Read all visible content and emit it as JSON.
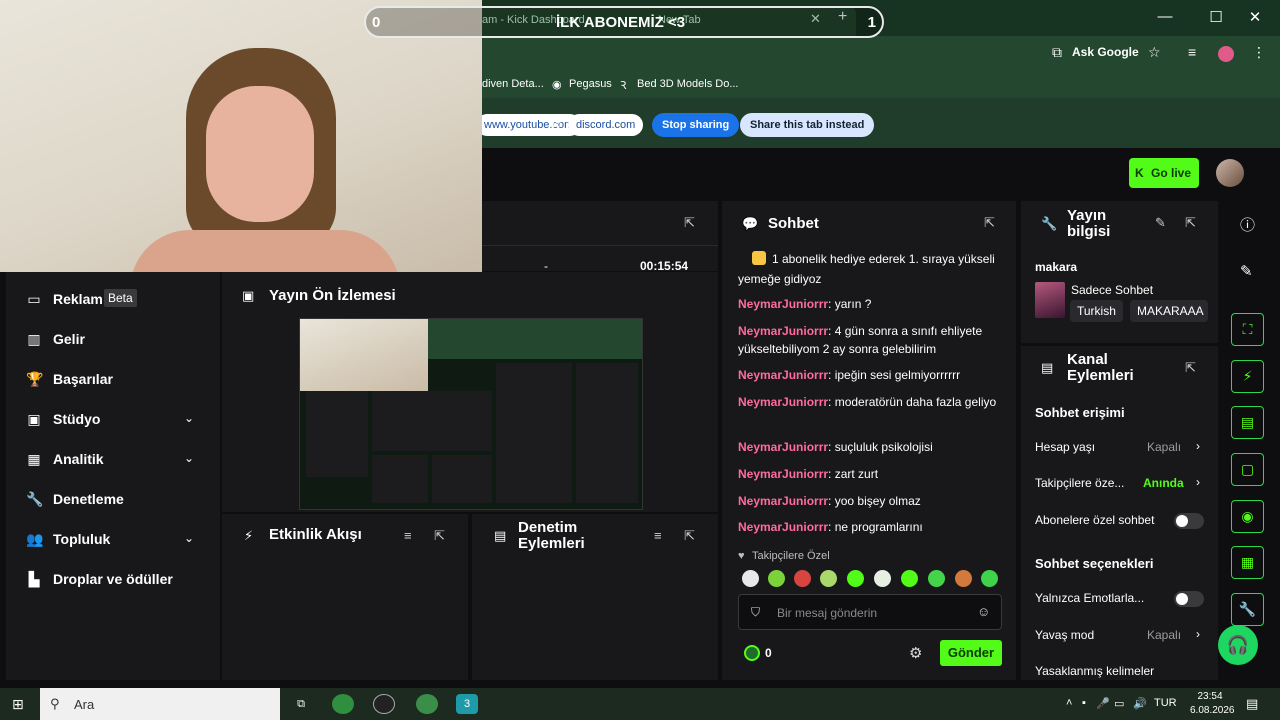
{
  "overlay": {
    "goal_left": "0",
    "goal_title": "İLK ABONEMİZ <3",
    "goal_right": "1"
  },
  "browser": {
    "tab_title": "am - Kick Dashboard",
    "tab_second": "New Tab",
    "close": "✕",
    "new_tab": "+",
    "ask_google": "Ask Google",
    "bookmarks": [
      "diven Deta...",
      "Pegasus",
      "Bed 3D Models Do..."
    ],
    "share_from": "www.youtube.com",
    "share_to_label": "to",
    "share_target": "discord.com",
    "stop_sharing": "Stop sharing",
    "share_tab": "Share this tab instead"
  },
  "kick": {
    "go_live": "Go live",
    "timer_value": "00:15:54",
    "timer_dash": "-",
    "nav": [
      {
        "label": "Reklam",
        "badge": "Beta",
        "icon": "▭"
      },
      {
        "label": "Gelir",
        "icon": "▥"
      },
      {
        "label": "Başarılar",
        "icon": "🏆"
      },
      {
        "label": "Stüdyo",
        "icon": "▣"
      },
      {
        "label": "Analitik",
        "icon": "▦"
      },
      {
        "label": "Denetleme",
        "icon": "🔧"
      },
      {
        "label": "Topluluk",
        "icon": "👥"
      },
      {
        "label": "Droplar ve ödüller",
        "icon": "▙"
      }
    ],
    "panels": {
      "preview": "Yayın Ön İzlemesi",
      "activity": "Etkinlik Akışı",
      "moderation_line1": "Denetim",
      "moderation_line2": "Eylemleri",
      "chat": "Sohbet",
      "stream_info_line1": "Yayın",
      "stream_info_line2": "bilgisi",
      "channel_actions_line1": "Kanal",
      "channel_actions_line2": "Eylemleri"
    },
    "chat": {
      "messages": [
        {
          "user": "",
          "text": "1 abonelik hediye ederek 1. sıraya yükseli",
          "badge": true
        },
        {
          "user": "",
          "text": "yemeğe gidiyoz"
        },
        {
          "user": "NeymarJuniorrr",
          "text": ": yarın ?"
        },
        {
          "user": "NeymarJuniorrr",
          "text": ": 4 gün sonra a sınıfı ehliyete yükseltebiliyom 2 ay sonra gelebilirim"
        },
        {
          "user": "NeymarJuniorrr",
          "text": ": ipeğin sesi gelmiyorrrrrr"
        },
        {
          "user": "NeymarJuniorrr",
          "text": ": moderatörün daha fazla geliyo"
        },
        {
          "user": "NeymarJuniorrr",
          "text": ": suçluluk psikolojisi"
        },
        {
          "user": "NeymarJuniorrr",
          "text": ": zart zurt"
        },
        {
          "user": "NeymarJuniorrr",
          "text": ": yoo bişey olmaz"
        },
        {
          "user": "NeymarJuniorrr",
          "text": ": ne programlarını"
        }
      ],
      "followers_only": "Takipçilere Özel",
      "input_placeholder": "Bir mesaj gönderin",
      "points": "0",
      "send": "Gönder"
    },
    "stream_info": {
      "title": "makara",
      "category": "Sadece Sohbet",
      "tags": [
        "Turkish",
        "MAKARAAA"
      ]
    },
    "channel_actions": {
      "chat_access": "Sohbet erişimi",
      "account_age_label": "Hesap yaşı",
      "account_age_value": "Kapalı",
      "followers_label": "Takipçilere öze...",
      "followers_value": "Anında",
      "subs_only_label": "Abonelere özel sohbet",
      "chat_options": "Sohbet seçenekleri",
      "emotes_only_label": "Yalnızca Emotlarla...",
      "slow_mode_label": "Yavaş mod",
      "slow_mode_value": "Kapalı",
      "banned_words_label": "Yasaklanmış kelimeler"
    }
  },
  "taskbar": {
    "search_placeholder": "Ara",
    "lang": "TUR",
    "time": "23:54",
    "date": "6.08.2026"
  }
}
